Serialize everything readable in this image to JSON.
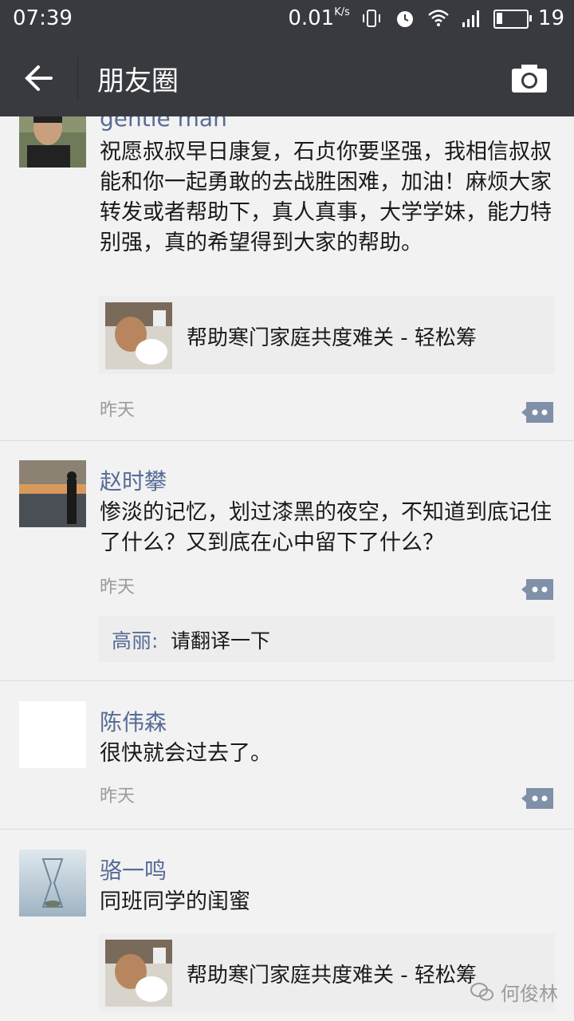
{
  "status_bar": {
    "time": "07:39",
    "network_speed": "0.01",
    "network_unit": "K/s",
    "battery": "19",
    "battery_level": 0.19
  },
  "nav": {
    "title": "朋友圈",
    "back_icon": "arrow-left-icon",
    "camera_icon": "camera-icon"
  },
  "posts": [
    {
      "name": "gentle man",
      "text": "祝愿叔叔早日康复，石贞你要坚强，我相信叔叔能和你一起勇敢的去战胜困难，加油！麻烦大家转发或者帮助下，真人真事，大学学妹，能力特别强，真的希望得到大家的帮助。",
      "link_title": "帮助寒门家庭共度难关 - 轻松筹",
      "time": "昨天"
    },
    {
      "name": "赵时攀",
      "text": "惨淡的记忆，划过漆黑的夜空，不知道到底记住了什么？又到底在心中留下了什么？",
      "time": "昨天",
      "comment": {
        "commenter": "高丽",
        "separator": ":",
        "text": "请翻译一下"
      }
    },
    {
      "name": "陈伟森",
      "text": "很快就会过去了。",
      "time": "昨天"
    },
    {
      "name": "骆一鸣",
      "text": "同班同学的闺蜜",
      "link_title": "帮助寒门家庭共度难关 - 轻松筹"
    }
  ],
  "watermark": {
    "text": "何俊林"
  },
  "colors": {
    "bar": "#393a3f",
    "name": "#576b95",
    "time": "#9b9b9b",
    "card": "#ededed",
    "comment_button": "#7f90a8"
  }
}
